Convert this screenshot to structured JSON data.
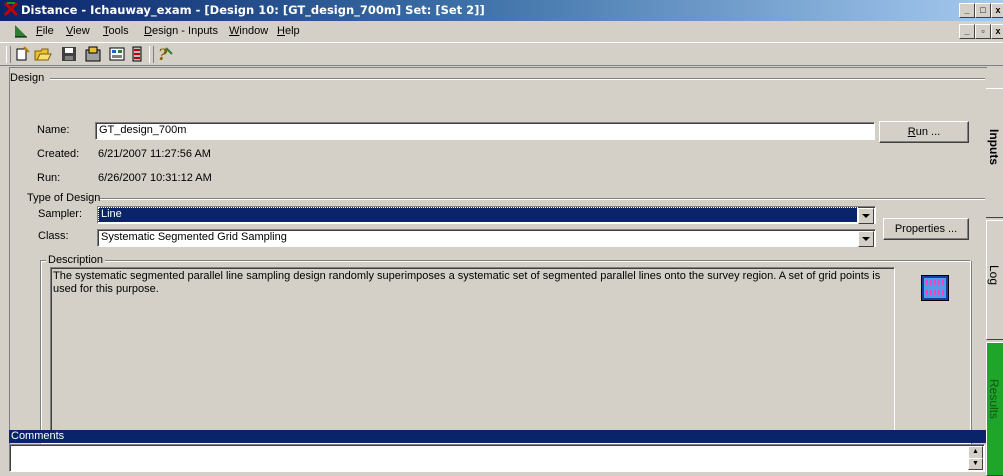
{
  "window": {
    "title": "Distance - Ichauway_exam - [Design 10: [GT_design_700m] Set: [Set 2]]"
  },
  "menu": {
    "items": [
      {
        "pre": "",
        "key": "F",
        "post": "ile"
      },
      {
        "pre": "",
        "key": "V",
        "post": "iew"
      },
      {
        "pre": "",
        "key": "T",
        "post": "ools"
      },
      {
        "pre": "",
        "key": "D",
        "post": "esign - Inputs"
      },
      {
        "pre": "",
        "key": "W",
        "post": "indow"
      },
      {
        "pre": "",
        "key": "H",
        "post": "elp"
      }
    ]
  },
  "design": {
    "group_label": "Design",
    "name_label": "Name:",
    "name_value": "GT_design_700m",
    "created_label": "Created:",
    "created_value": "6/21/2007 11:27:56 AM",
    "run_label": "Run:",
    "run_value": "6/26/2007 10:31:12 AM",
    "run_button": {
      "key": "R",
      "post": "un ..."
    }
  },
  "type_of_design": {
    "group_label": "Type of Design",
    "sampler_label": "Sampler:",
    "sampler_value": "Line",
    "class_label": "Class:",
    "class_value": "Systematic Segmented Grid Sampling",
    "properties_button": "Properties ..."
  },
  "description": {
    "group_label": "Description",
    "text": "The systematic segmented parallel line sampling design randomly superimposes a systematic set of segmented parallel lines onto the survey region.  A set of grid points is used for this purpose."
  },
  "tabs": {
    "inputs": "Inputs",
    "log": "Log",
    "results": "Results"
  },
  "comments": {
    "label": "Comments",
    "value": ""
  },
  "colors": {
    "accent": "#0a246a",
    "results_tab": "#1fa52a",
    "window_bg": "#d4d0c8"
  }
}
